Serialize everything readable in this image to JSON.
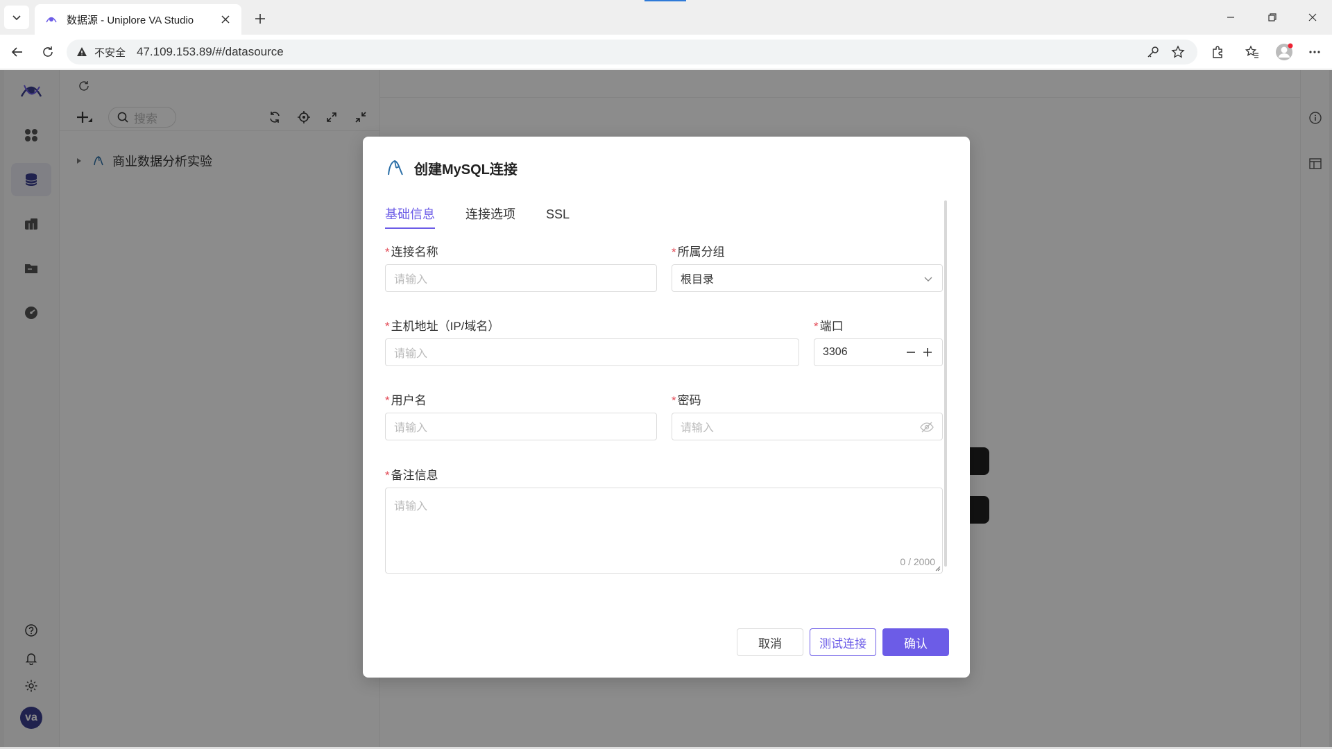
{
  "browser": {
    "tab_title": "数据源 - Uniplore VA Studio",
    "security_label": "不安全",
    "url": "47.109.153.89/#/datasource"
  },
  "sidebar": {
    "items": [
      {
        "icon": "apps-icon"
      },
      {
        "icon": "database-icon",
        "active": true
      },
      {
        "icon": "dataset-icon"
      },
      {
        "icon": "folder-icon"
      },
      {
        "icon": "dashboard-icon"
      }
    ],
    "bottom": [
      {
        "icon": "help-icon"
      },
      {
        "icon": "bell-icon"
      },
      {
        "icon": "gear-icon"
      }
    ],
    "avatar_text": "va"
  },
  "tree_panel": {
    "search_placeholder": "搜索",
    "nodes": [
      {
        "label": "商业数据分析实验",
        "type": "mysql"
      }
    ]
  },
  "dialog": {
    "title": "创建MySQL连接",
    "tabs": [
      "基础信息",
      "连接选项",
      "SSL"
    ],
    "active_tab": 0,
    "fields": {
      "name": {
        "label": "连接名称",
        "placeholder": "请输入",
        "value": ""
      },
      "group": {
        "label": "所属分组",
        "value": "根目录"
      },
      "host": {
        "label": "主机地址（IP/域名）",
        "placeholder": "请输入",
        "value": ""
      },
      "port": {
        "label": "端口",
        "value": "3306"
      },
      "username": {
        "label": "用户名",
        "placeholder": "请输入",
        "value": ""
      },
      "password": {
        "label": "密码",
        "placeholder": "请输入",
        "value": ""
      },
      "remark": {
        "label": "备注信息",
        "placeholder": "请输入",
        "counter": "0 / 2000"
      }
    },
    "buttons": {
      "cancel": "取消",
      "test": "测试连接",
      "confirm": "确认"
    }
  },
  "colors": {
    "primary": "#6c5ce7",
    "required": "#e34d59"
  }
}
